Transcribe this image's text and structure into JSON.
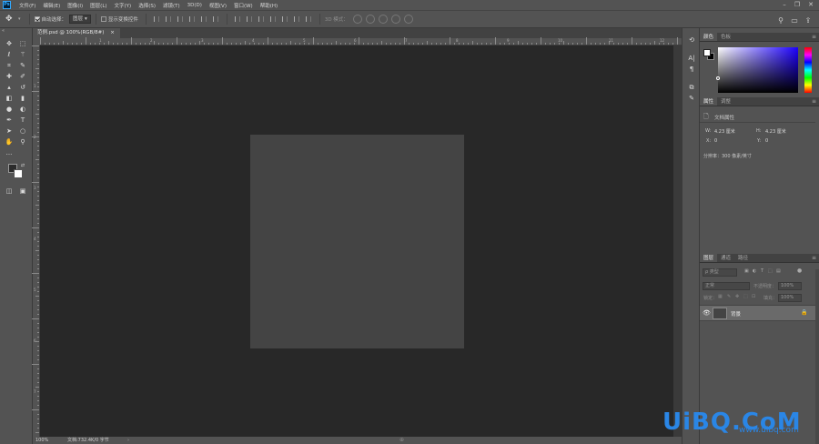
{
  "app": {
    "logo": "Ps",
    "accent": "#31a8ff"
  },
  "menu": [
    "文件(F)",
    "编辑(E)",
    "图像(I)",
    "图层(L)",
    "文字(Y)",
    "选择(S)",
    "滤镜(T)",
    "3D(D)",
    "视图(V)",
    "窗口(W)",
    "帮助(H)"
  ],
  "window_controls": {
    "minimize": "–",
    "restore": "❐",
    "close": "✕"
  },
  "options": {
    "move_icon": "move-icon",
    "auto_select_label": "自动选择：",
    "auto_select_checked": true,
    "auto_select_value": "图层",
    "show_transform_label": "显示变换控件",
    "show_transform_checked": false,
    "mode_3d_label": "3D 模式："
  },
  "document": {
    "tab_title": "范例.psd @ 100%(RGB/8#)",
    "tab_close": "×",
    "zoom": "100%",
    "doc_info": "文档:732.4K/0 字节",
    "canvas_color": "#444444"
  },
  "ruler": {
    "top_numbers": [
      "1",
      "2",
      "3",
      "4",
      "5",
      "6",
      "7",
      "8",
      "9",
      "10",
      "11",
      "12"
    ],
    "left_numbers": [
      "1",
      "2",
      "3",
      "4",
      "5",
      "6",
      "7"
    ]
  },
  "color_panel": {
    "tabs": [
      "颜色",
      "色板"
    ],
    "foreground": "#ffffff",
    "background": "#000000",
    "hue": "#1c00ff"
  },
  "properties_panel": {
    "tabs": [
      "属性",
      "调整"
    ],
    "title": "文档属性",
    "w_label": "W:",
    "w_value": "4.23 厘米",
    "h_label": "H:",
    "h_value": "4.23 厘米",
    "x_label": "X:",
    "x_value": "0",
    "y_label": "Y:",
    "y_value": "0",
    "resolution": "分辨率：300 像素/英寸"
  },
  "layers_panel": {
    "tabs": [
      "图层",
      "通道",
      "路径"
    ],
    "filter_placeholder": "ρ 类型",
    "blend_mode": "正常",
    "opacity_label": "不透明度：",
    "opacity_value": "100%",
    "lock_label": "锁定：",
    "fill_label": "填充：",
    "fill_value": "100%",
    "layer_name": "背景"
  },
  "watermark": {
    "text": "UiBQ.CoM",
    "small": "www.uibq.com"
  }
}
